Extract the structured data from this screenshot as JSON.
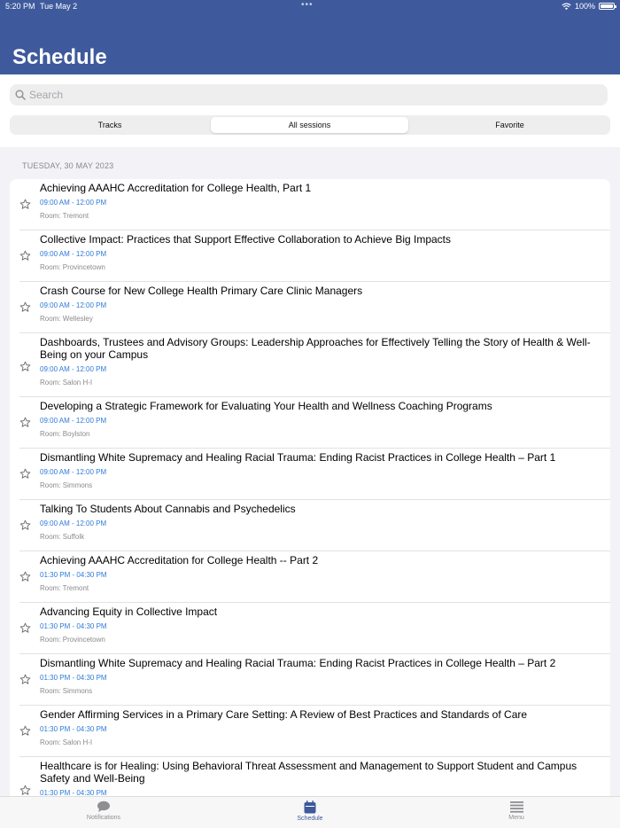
{
  "status": {
    "time": "5:20 PM",
    "date": "Tue May 2",
    "battery": "100%"
  },
  "page_title": "Schedule",
  "search": {
    "placeholder": "Search"
  },
  "segments": [
    "Tracks",
    "All sessions",
    "Favorite"
  ],
  "section_header": "TUESDAY, 30 MAY 2023",
  "sessions": [
    {
      "title": "Achieving AAAHC Accreditation for College Health, Part 1",
      "time": "09:00 AM - 12:00 PM",
      "room": "Room: Tremont"
    },
    {
      "title": "Collective Impact: Practices that Support Effective Collaboration to Achieve Big Impacts",
      "time": "09:00 AM - 12:00 PM",
      "room": "Room: Provincetown"
    },
    {
      "title": "Crash Course for New College Health Primary Care Clinic Managers",
      "time": "09:00 AM - 12:00 PM",
      "room": "Room: Wellesley"
    },
    {
      "title": "Dashboards, Trustees and Advisory Groups: Leadership Approaches for Effectively Telling the Story of Health & Well-Being on your Campus",
      "time": "09:00 AM - 12:00 PM",
      "room": "Room: Salon H-I"
    },
    {
      "title": "Developing a Strategic Framework for Evaluating Your Health and Wellness Coaching Programs",
      "time": "09:00 AM - 12:00 PM",
      "room": "Room: Boylston"
    },
    {
      "title": "Dismantling White Supremacy and Healing Racial Trauma: Ending Racist Practices in College Health – Part 1",
      "time": "09:00 AM - 12:00 PM",
      "room": "Room: Simmons"
    },
    {
      "title": "Talking To Students About Cannabis and Psychedelics",
      "time": "09:00 AM - 12:00 PM",
      "room": "Room: Suffolk"
    },
    {
      "title": "Achieving AAAHC Accreditation for College Health -- Part 2",
      "time": "01:30 PM - 04:30 PM",
      "room": "Room: Tremont"
    },
    {
      "title": "Advancing Equity in Collective Impact",
      "time": "01:30 PM - 04:30 PM",
      "room": "Room: Provincetown"
    },
    {
      "title": "Dismantling White Supremacy and Healing Racial Trauma: Ending Racist Practices in College Health – Part 2",
      "time": "01:30 PM - 04:30 PM",
      "room": "Room: Simmons"
    },
    {
      "title": "Gender Affirming Services in a Primary Care Setting: A Review of Best Practices and Standards of Care",
      "time": "01:30 PM - 04:30 PM",
      "room": "Room: Salon H-I"
    },
    {
      "title": "Healthcare is for Healing: Using Behavioral Threat Assessment and Management to Support Student and Campus Safety and Well-Being",
      "time": "01:30 PM - 04:30 PM",
      "room": ""
    }
  ],
  "tabbar": [
    {
      "label": "Notifications",
      "icon": "speech-bubble-icon"
    },
    {
      "label": "Schedule",
      "icon": "calendar-icon"
    },
    {
      "label": "Menu",
      "icon": "hamburger-menu-icon"
    }
  ],
  "colors": {
    "header": "#3e5a9c",
    "time_text": "#2f7ad9",
    "active_tab": "#3e5a9c"
  }
}
